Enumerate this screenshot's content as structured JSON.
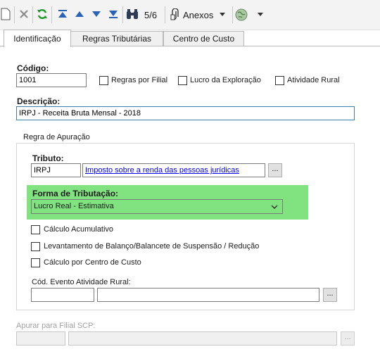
{
  "toolbar": {
    "record_counter": "5/6",
    "attachments_label": "Anexos"
  },
  "tabs": [
    {
      "label": "Identificação",
      "active": true
    },
    {
      "label": "Regras Tributárias",
      "active": false
    },
    {
      "label": "Centro de Custo",
      "active": false
    }
  ],
  "form": {
    "code_label": "Código:",
    "code_value": "1001",
    "rules_by_branch_label": "Regras por Filial",
    "exploration_profit_label": "Lucro da Exploração",
    "rural_activity_label": "Atividade Rural",
    "description_label": "Descrição:",
    "description_value": "IRPJ - Receita Bruta Mensal - 2018"
  },
  "apuration_group": {
    "title": "Regra de Apuração",
    "tax_label": "Tributo:",
    "tax_code": "IRPJ",
    "tax_description": "Imposto sobre a renda das pessoas jurídicas",
    "taxation_form_label": "Forma de Tributação:",
    "taxation_form_value": "Lucro Real - Estimativa",
    "highlight_color": "#80e380",
    "cumulative_calc_label": "Cálculo Acumulativo",
    "balance_survey_label": "Levantamento de Balanço/Balancete de Suspensão / Redução",
    "cost_center_calc_label": "Cálculo por Centro de Custo",
    "rural_event_code_label": "Cód. Evento Atividade Rural:",
    "rural_event_code_value": "",
    "rural_event_description_value": ""
  },
  "scp": {
    "label": "Apurar para Filial SCP:",
    "code_value": "",
    "description_value": ""
  },
  "ellipsis": "..."
}
